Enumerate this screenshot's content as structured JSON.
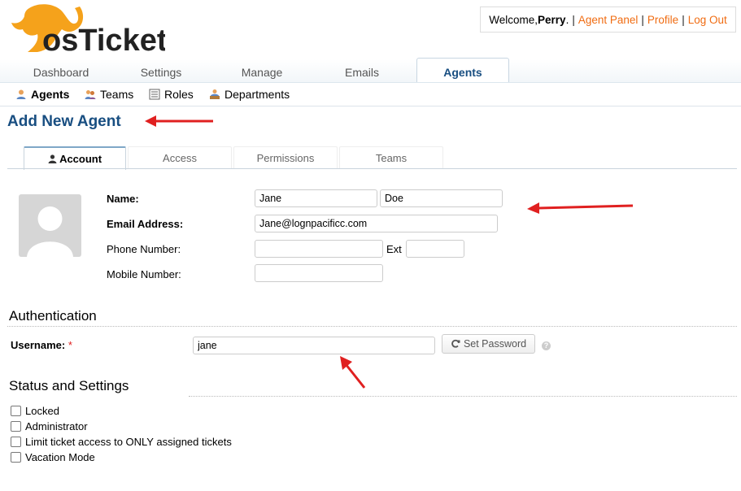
{
  "header": {
    "logo_text": "osTicket",
    "welcome_prefix": "Welcome, ",
    "user_name": "Perry",
    "welcome_suffix": ".",
    "links": [
      "Agent Panel",
      "Profile",
      "Log Out"
    ]
  },
  "nav": {
    "tabs": [
      "Dashboard",
      "Settings",
      "Manage",
      "Emails",
      "Agents"
    ],
    "active": "Agents"
  },
  "subnav": {
    "items": [
      {
        "label": "Agents",
        "icon": "agent-icon",
        "active": true
      },
      {
        "label": "Teams",
        "icon": "teams-icon",
        "active": false
      },
      {
        "label": "Roles",
        "icon": "roles-icon",
        "active": false
      },
      {
        "label": "Departments",
        "icon": "departments-icon",
        "active": false
      }
    ]
  },
  "page_title": "Add New Agent",
  "form_tabs": [
    {
      "label": "Account",
      "icon": "user-icon",
      "active": true
    },
    {
      "label": "Access",
      "active": false
    },
    {
      "label": "Permissions",
      "active": false
    },
    {
      "label": "Teams",
      "active": false
    }
  ],
  "account": {
    "name_label": "Name:",
    "first_name": "Jane",
    "last_name": "Doe",
    "email_label": "Email Address:",
    "email": "Jane@lognpacificc.com",
    "phone_label": "Phone Number:",
    "phone": "",
    "ext_label": "Ext",
    "ext": "",
    "mobile_label": "Mobile Number:",
    "mobile": ""
  },
  "authentication": {
    "title": "Authentication",
    "username_label": "Username:",
    "required_mark": "*",
    "username": "jane",
    "set_password_label": "Set Password",
    "help_glyph": "?"
  },
  "status": {
    "title": "Status and Settings",
    "options": [
      {
        "label": "Locked",
        "checked": false
      },
      {
        "label": "Administrator",
        "checked": false
      },
      {
        "label": "Limit ticket access to ONLY assigned tickets",
        "checked": false
      },
      {
        "label": "Vacation Mode",
        "checked": false
      }
    ]
  },
  "colors": {
    "accent_link": "#f06c12",
    "title_blue": "#184e81",
    "annotation_arrow": "#e02020"
  }
}
